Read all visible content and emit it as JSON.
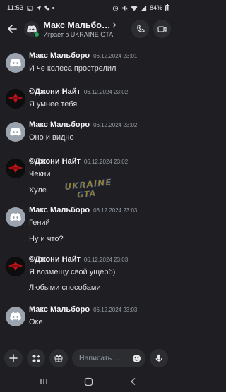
{
  "status_bar": {
    "time": "11:53",
    "battery": "84%"
  },
  "header": {
    "title": "Макс Мальбо…",
    "subtitle": "Играет в UKRAINE GTA"
  },
  "watermark": {
    "top": "UKRAINE",
    "bottom": "GTA"
  },
  "messages": [
    {
      "author": "Макс Мальборо",
      "time": "06.12.2024 23:01",
      "avatar": "discord-logo-icon",
      "lines": [
        "И че колеса прострелил"
      ]
    },
    {
      "author": "©Джони Найт",
      "time": "06.12.2024 23:02",
      "avatar": "red-emblem-icon",
      "lines": [
        "Я умнее тебя"
      ]
    },
    {
      "author": "Макс Мальборо",
      "time": "06.12.2024 23:02",
      "avatar": "discord-logo-icon",
      "lines": [
        "Оно и видно"
      ]
    },
    {
      "author": "©Джони Найт",
      "time": "06.12.2024 23:02",
      "avatar": "red-emblem-icon",
      "lines": [
        "Чекни",
        "Хуле"
      ]
    },
    {
      "author": "Макс Мальборо",
      "time": "06.12.2024 23:03",
      "avatar": "discord-logo-icon",
      "lines": [
        "Гений",
        "Ну и что?"
      ]
    },
    {
      "author": "©Джони Найт",
      "time": "06.12.2024 23:03",
      "avatar": "red-emblem-icon",
      "lines": [
        "Я возмещу свой ущерб)",
        "Любыми способами"
      ]
    },
    {
      "author": "Макс Мальборо",
      "time": "06.12.2024 23:03",
      "avatar": "discord-logo-icon",
      "lines": [
        "Оке"
      ]
    }
  ],
  "input": {
    "placeholder": "Написать …"
  },
  "colors": {
    "background": "#1f1f23",
    "online": "#23a55a",
    "button_bg": "#2b2d31"
  }
}
